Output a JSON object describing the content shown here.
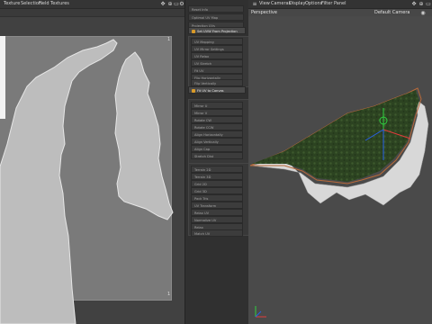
{
  "uv_editor": {
    "menu": [
      "Texture",
      "Selection",
      "Field",
      "Textures"
    ],
    "toolbar_icons": [
      "move-icon",
      "zoom-icon",
      "fit-icon",
      "gear-icon"
    ],
    "corner_labels": {
      "tr": "1",
      "br": "1"
    }
  },
  "uv_commands": {
    "top_buttons": [
      "Reset Info",
      "Optimal UV Map",
      "Projection UVs"
    ],
    "active_buttons": [
      "Set UVW From Projection",
      "Fit UV to Canvas"
    ],
    "group1": [
      "UV Mapping",
      "UV Mirror Settings",
      "UV Relax",
      "UV Stretch",
      "Fit UV",
      "Flip Horizontally",
      "Flip Vertically"
    ],
    "group2": [
      "Mirror U",
      "Mirror V",
      "Rotate CW",
      "Rotate CCW",
      "Align Horizontally",
      "Align Vertically",
      "Align Cap",
      "Stretch Dist"
    ],
    "group3": [
      "Terrain 2D",
      "Terrain 3D",
      "Grid 2D",
      "Grid 3D",
      "Pack Tris",
      "UV Transform",
      "Relax UV",
      "Normalize UV",
      "Relax",
      "Match UV"
    ],
    "icon_color": "#d99a28"
  },
  "viewport": {
    "menu": [
      "View",
      "Cameras",
      "Display",
      "Options",
      "Filter",
      "Panel"
    ],
    "label": "Perspective",
    "camera": "Default Camera",
    "camera_icon": "camera-icon",
    "axis_icon": "axis-gizmo-icon"
  }
}
